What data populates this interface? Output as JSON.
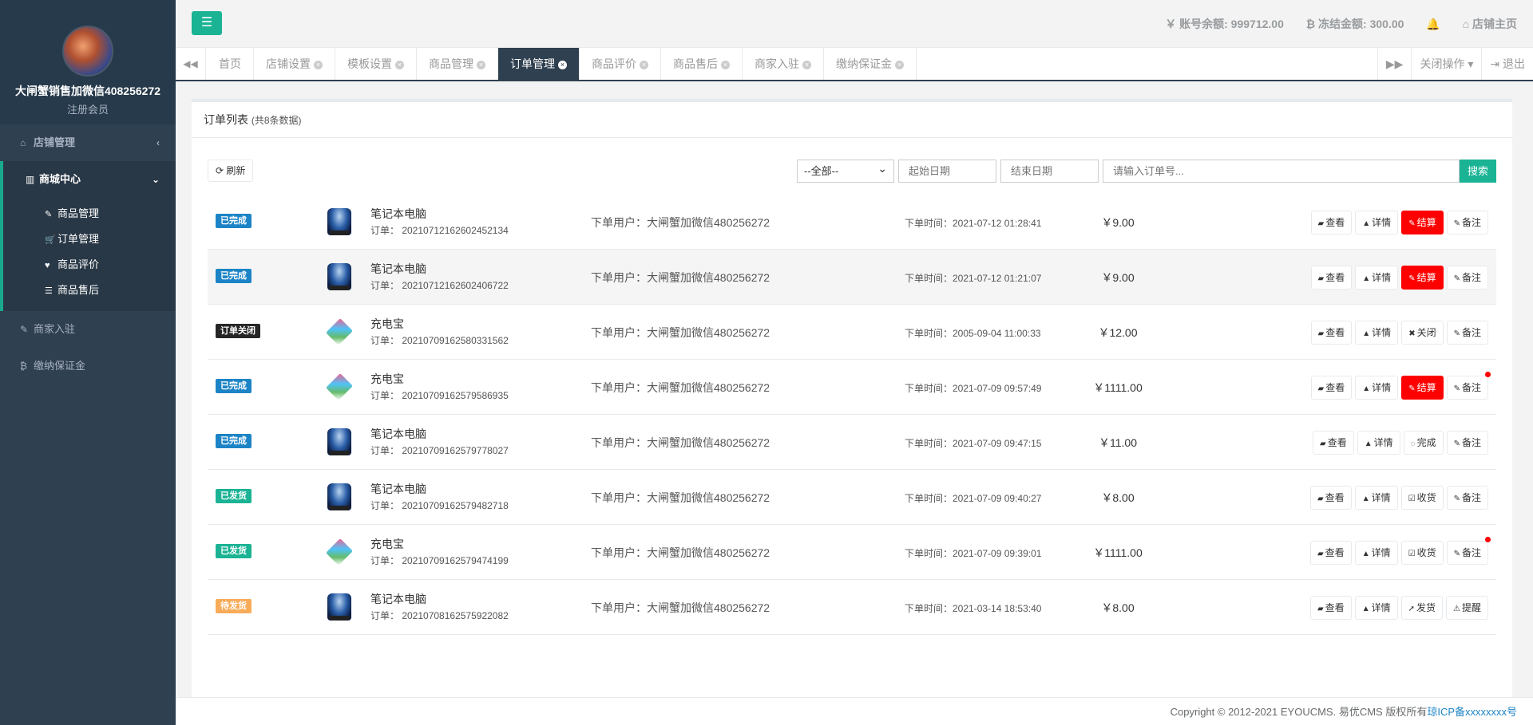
{
  "sidebar": {
    "user_name": "大闸蟹销售加微信408256272",
    "user_role": "注册会员",
    "menu": [
      {
        "label": "店铺管理",
        "icon": "home-icon"
      },
      {
        "label": "商城中心",
        "icon": "bar-chart-icon"
      },
      {
        "label": "商家入驻",
        "icon": "edit-icon"
      },
      {
        "label": "缴纳保证金",
        "icon": "bitcoin-icon"
      }
    ],
    "submenu": [
      {
        "label": "商品管理",
        "icon": "edit-square-icon"
      },
      {
        "label": "订单管理",
        "icon": "cart-icon"
      },
      {
        "label": "商品评价",
        "icon": "heart-icon"
      },
      {
        "label": "商品售后",
        "icon": "database-icon"
      }
    ]
  },
  "topbar": {
    "balance": "￥ 账号余额: 999712.00",
    "frozen": "₿ 冻结金额: 300.00",
    "shop_home": "店铺主页"
  },
  "tabs": [
    "首页",
    "店铺设置",
    "模板设置",
    "商品管理",
    "订单管理",
    "商品评价",
    "商品售后",
    "商家入驻",
    "缴纳保证金"
  ],
  "tab_actions": {
    "close_ops": "关闭操作",
    "logout": "退出"
  },
  "panel": {
    "title": "订单列表",
    "count": "(共8条数据)"
  },
  "toolbar": {
    "refresh": "刷新",
    "status_select": "--全部--",
    "start_date_placeholder": "起始日期",
    "end_date_placeholder": "结束日期",
    "order_placeholder": "请输入订单号...",
    "search": "搜索"
  },
  "orders": [
    {
      "status": "已完成",
      "status_color": "#1c84c6",
      "name": "笔记本电脑",
      "order_no": "订单： 20210712162602452134",
      "user": "下单用户：大闸蟹加微信480256272",
      "time": "下单时间：2021-07-12 01:28:41",
      "price": "￥9.00",
      "actions": [
        "查看",
        "详情",
        "结算",
        "备注"
      ]
    },
    {
      "status": "已完成",
      "status_color": "#1c84c6",
      "name": "笔记本电脑",
      "order_no": "订单： 20210712162602406722",
      "user": "下单用户：大闸蟹加微信480256272",
      "time": "下单时间：2021-07-12 01:21:07",
      "price": "￥9.00",
      "actions": [
        "查看",
        "详情",
        "结算",
        "备注"
      ]
    },
    {
      "status": "订单关闭",
      "status_color": "#262626",
      "name": "充电宝",
      "order_no": "订单： 20210709162580331562",
      "user": "下单用户：大闸蟹加微信480256272",
      "time": "下单时间：2005-09-04 11:00:33",
      "price": "￥12.00",
      "actions": [
        "查看",
        "详情",
        "关闭",
        "备注"
      ]
    },
    {
      "status": "已完成",
      "status_color": "#1c84c6",
      "name": "充电宝",
      "order_no": "订单： 20210709162579586935",
      "user": "下单用户：大闸蟹加微信480256272",
      "time": "下单时间：2021-07-09 09:57:49",
      "price": "￥1111.00",
      "actions": [
        "查看",
        "详情",
        "结算",
        "备注"
      ]
    },
    {
      "status": "已完成",
      "status_color": "#1c84c6",
      "name": "笔记本电脑",
      "order_no": "订单： 20210709162579778027",
      "user": "下单用户：大闸蟹加微信480256272",
      "time": "下单时间：2021-07-09 09:47:15",
      "price": "￥11.00",
      "actions": [
        "查看",
        "详情",
        "完成",
        "备注"
      ]
    },
    {
      "status": "已发货",
      "status_color": "#1ab394",
      "name": "笔记本电脑",
      "order_no": "订单： 20210709162579482718",
      "user": "下单用户：大闸蟹加微信480256272",
      "time": "下单时间：2021-07-09 09:40:27",
      "price": "￥8.00",
      "actions": [
        "查看",
        "详情",
        "收货",
        "备注"
      ]
    },
    {
      "status": "已发货",
      "status_color": "#1ab394",
      "name": "充电宝",
      "order_no": "订单： 20210709162579474199",
      "user": "下单用户：大闸蟹加微信480256272",
      "time": "下单时间：2021-07-09 09:39:01",
      "price": "￥1111.00",
      "actions": [
        "查看",
        "详情",
        "收货",
        "备注"
      ]
    },
    {
      "status": "待发货",
      "status_color": "#f8ac59",
      "name": "笔记本电脑",
      "order_no": "订单： 20210708162575922082",
      "user": "下单用户：大闸蟹加微信480256272",
      "time": "下单时间：2021-03-14 18:53:40",
      "price": "￥8.00",
      "actions": [
        "查看",
        "详情",
        "发货",
        "提醒"
      ]
    }
  ],
  "footer": {
    "copyright": "Copyright © 2012-2021 EYOUCMS. 易优CMS 版权所有",
    "icp": "琼ICP备xxxxxxxx号"
  }
}
